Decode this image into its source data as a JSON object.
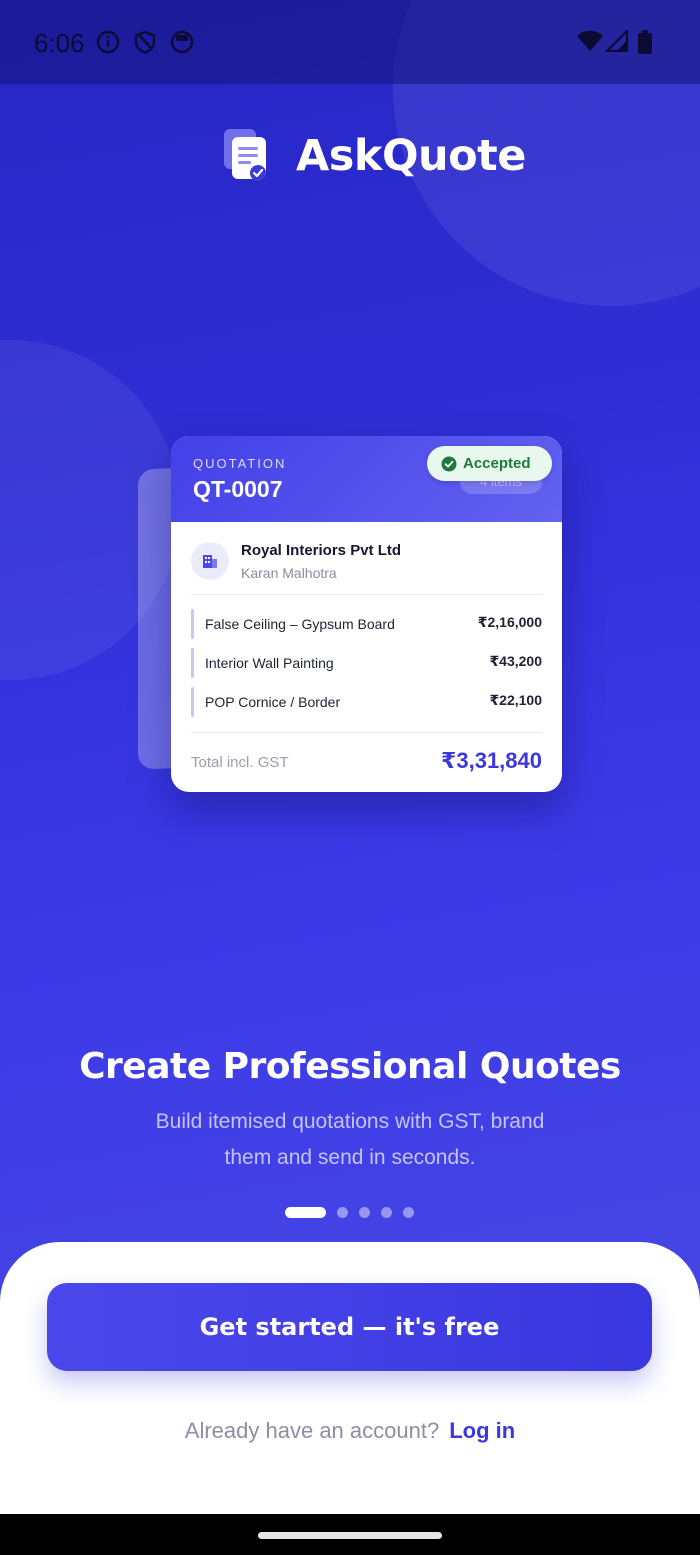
{
  "status_bar": {
    "time": "6:06",
    "icons": [
      "info-icon",
      "shield-icon",
      "camera-icon",
      "wifi-icon",
      "signal-icon",
      "battery-icon"
    ]
  },
  "brand": {
    "name": "AskQuote",
    "logo_icon": "document-check-icon"
  },
  "quote_card": {
    "kicker": "QUOTATION",
    "number": "QT-0007",
    "items_pill": "4 items",
    "status": "Accepted",
    "client_name": "Royal Interiors Pvt Ltd",
    "client_contact": "Karan Malhotra",
    "line_items": [
      {
        "name": "False Ceiling – Gypsum Board",
        "amount": "₹2,16,000"
      },
      {
        "name": "Interior Wall Painting",
        "amount": "₹43,200"
      },
      {
        "name": "POP Cornice / Border",
        "amount": "₹22,100"
      }
    ],
    "total_label": "Total incl. GST",
    "total_value": "₹3,31,840"
  },
  "hero": {
    "title": "Create Professional Quotes",
    "subtitle": "Build itemised quotations with GST, brand them and send in seconds."
  },
  "carousel": {
    "pages": 5,
    "active_index": 0
  },
  "actions": {
    "primary_label": "Get started — it's free",
    "login_prompt": "Already have an account?",
    "login_link": "Log in"
  },
  "colors": {
    "primary": "#3b39d9",
    "background_gradient": [
      "#2626c4",
      "#4b4ce0"
    ],
    "accepted_badge": "#1d7a3e"
  }
}
